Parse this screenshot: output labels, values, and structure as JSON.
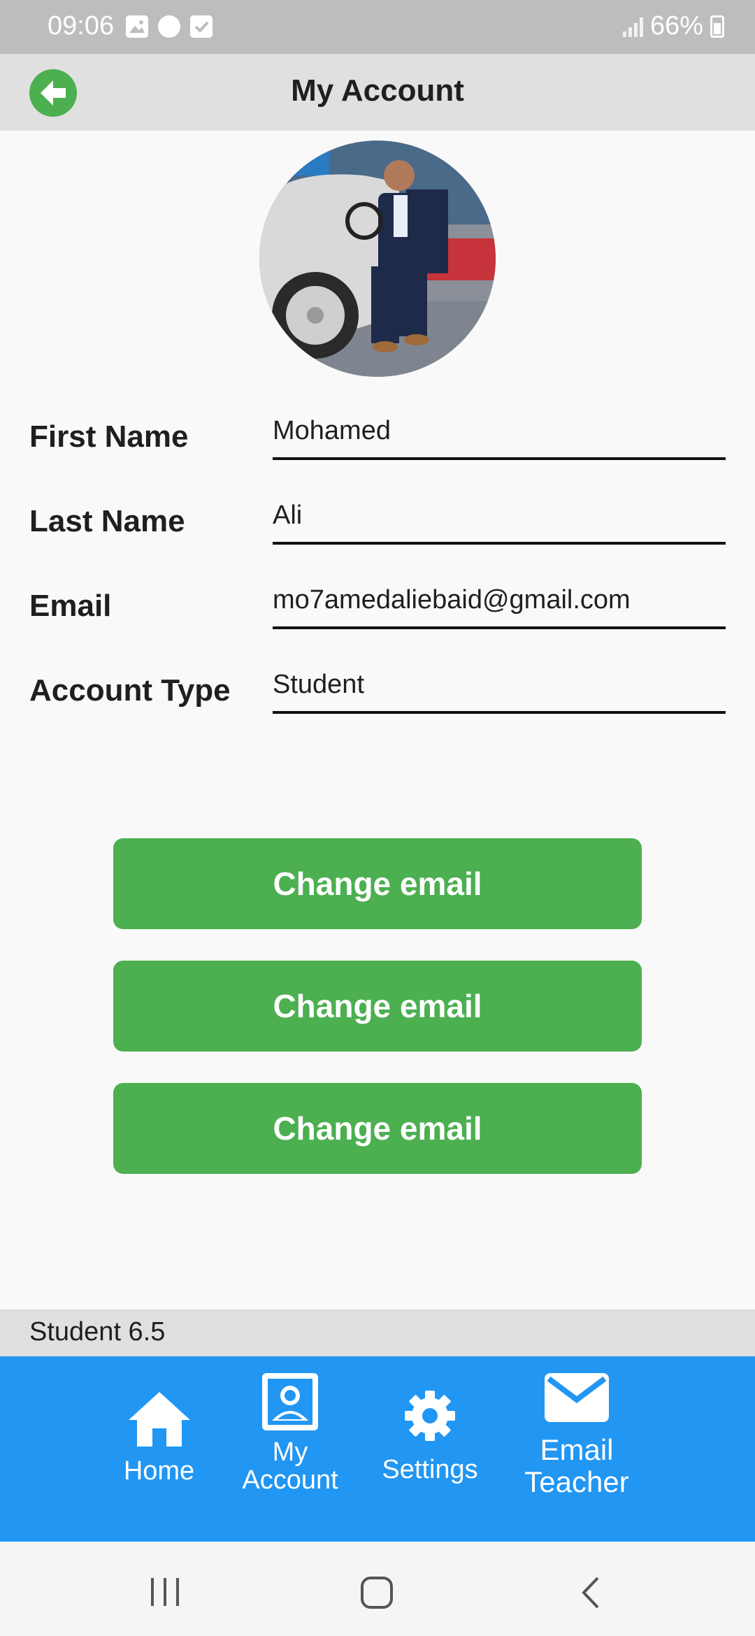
{
  "status_bar": {
    "time": "09:06",
    "battery": "66%",
    "icons": [
      "gallery-icon",
      "chat-icon",
      "check-icon",
      "signal-icon",
      "battery-icon"
    ]
  },
  "app_bar": {
    "title": "My Account",
    "back_icon": "back-arrow-icon",
    "accent": "#4caf50"
  },
  "profile": {
    "avatar_icon": "profile-photo"
  },
  "fields": [
    {
      "label": "First Name",
      "value": "Mohamed"
    },
    {
      "label": "Last Name",
      "value": "Ali"
    },
    {
      "label": "Email",
      "value": "mo7amedaliebaid@gmail.com"
    },
    {
      "label": "Account Type",
      "value": "Student"
    }
  ],
  "buttons": [
    {
      "label": "Change email"
    },
    {
      "label": "Change email"
    },
    {
      "label": "Change email"
    }
  ],
  "version": {
    "text": "Student 6.5"
  },
  "bottom_nav": {
    "color": "#2196f3",
    "items": [
      {
        "label": "Home",
        "icon": "home-icon"
      },
      {
        "label": "My\nAccount",
        "icon": "account-icon"
      },
      {
        "label": "Settings",
        "icon": "gear-icon"
      },
      {
        "label": "Email\nTeacher",
        "icon": "mail-icon"
      }
    ]
  },
  "system_nav": {
    "icons": [
      "recents-icon",
      "home-circle-icon",
      "back-icon"
    ]
  }
}
